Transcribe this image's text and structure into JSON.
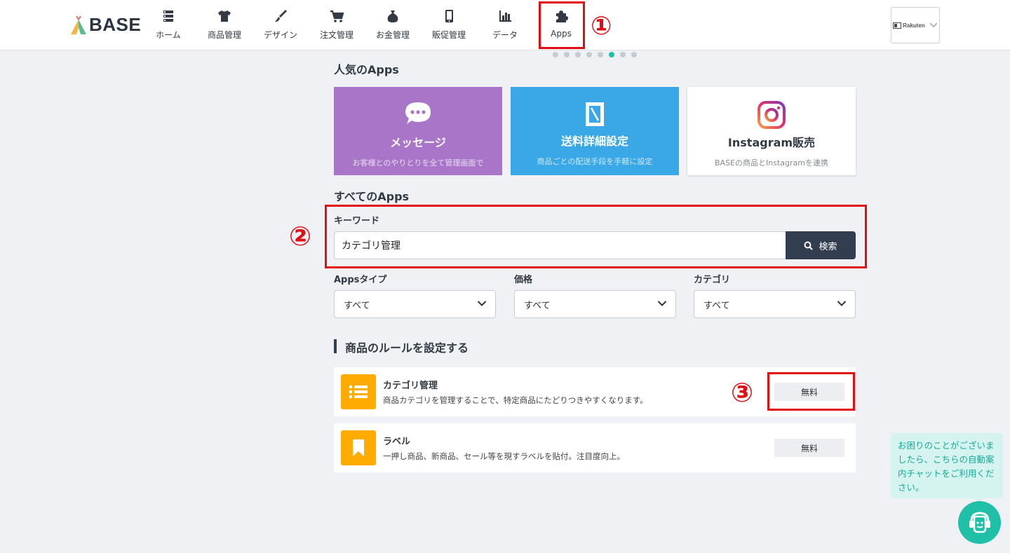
{
  "header": {
    "logo_text": "BASE",
    "nav": [
      {
        "label": "ホーム",
        "icon": "home-list-icon"
      },
      {
        "label": "商品管理",
        "icon": "tshirt-icon"
      },
      {
        "label": "デザイン",
        "icon": "paintbrush-icon"
      },
      {
        "label": "注文管理",
        "icon": "cart-icon"
      },
      {
        "label": "お金管理",
        "icon": "money-bag-icon"
      },
      {
        "label": "販促管理",
        "icon": "smartphone-icon"
      },
      {
        "label": "データ",
        "icon": "bar-chart-icon"
      },
      {
        "label": "Apps",
        "icon": "puzzle-icon"
      }
    ],
    "store_switcher_label": "Rakuten"
  },
  "annotations": {
    "one": "①",
    "two": "②",
    "three": "③"
  },
  "carousel": {
    "dot_count": 8,
    "active_index": 5
  },
  "popular": {
    "title": "人気のApps",
    "cards": [
      {
        "title": "メッセージ",
        "desc": "お客様とのやりとりを全て管理画面で",
        "color": "#a975c8"
      },
      {
        "title": "送料詳細設定",
        "desc": "商品ごとの配送手段を手軽に設定",
        "color": "#3aa8e6"
      },
      {
        "title": "Instagram販売",
        "desc": "BASEの商品とInstagramを連携",
        "color": "#ffffff"
      }
    ]
  },
  "all_apps": {
    "title": "すべてのApps",
    "keyword_label": "キーワード",
    "keyword_value": "カテゴリ管理",
    "search_button": "検索",
    "filters": [
      {
        "label": "Appsタイプ",
        "value": "すべて"
      },
      {
        "label": "価格",
        "value": "すべて"
      },
      {
        "label": "カテゴリ",
        "value": "すべて"
      }
    ]
  },
  "results": {
    "section_title": "商品のルールを設定する",
    "apps": [
      {
        "name": "カテゴリ管理",
        "desc": "商品カテゴリを管理することで、特定商品にたどりつきやすくなります。",
        "price": "無料"
      },
      {
        "name": "ラベル",
        "desc": "一押し商品、新商品、セール等を現すラベルを貼付。注目度向上。",
        "price": "無料"
      }
    ]
  },
  "chat": {
    "message": "お困りのことがございましたら、こちらの自動案内チャットをご利用ください。"
  },
  "colors": {
    "accent": "#1fbfa8",
    "annotation_red": "#e20f12",
    "app_icon": "#ffab00",
    "dark_button": "#333d50"
  }
}
